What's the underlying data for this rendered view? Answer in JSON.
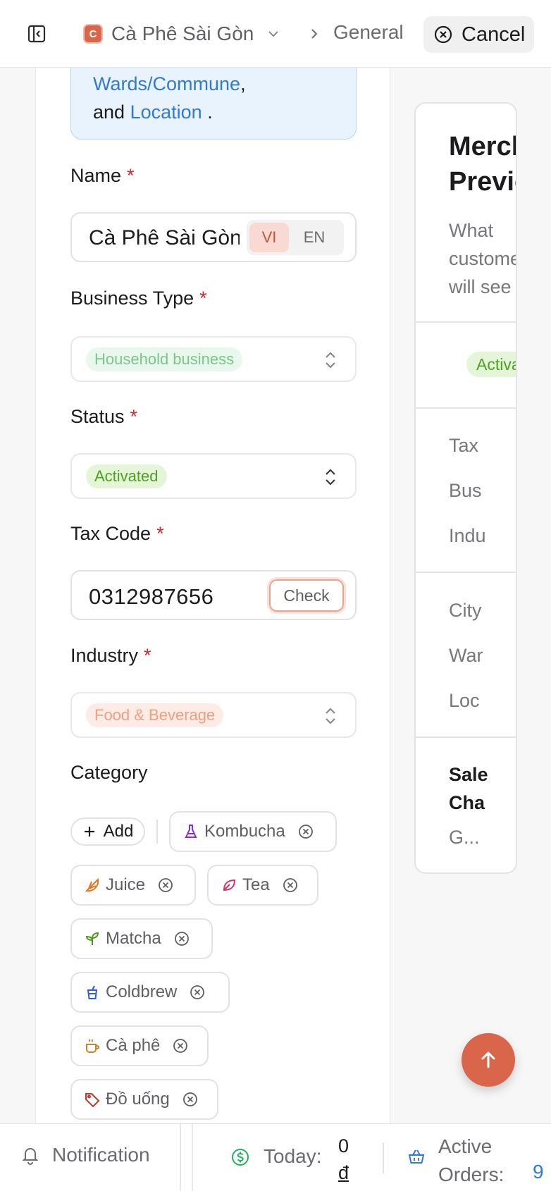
{
  "header": {
    "merchant_initial": "C",
    "merchant_name": "Cà Phê Sài Gòn",
    "breadcrumb_current": "General",
    "cancel_label": "Cancel"
  },
  "form": {
    "info_box": {
      "line1_link": "Wards/Commune",
      "line1_suffix": ",",
      "line2_prefix": "and",
      "line2_link": "Location",
      "line2_suffix": "."
    },
    "name": {
      "label": "Name",
      "required_mark": "*",
      "value": "Cà Phê Sài Gòn",
      "lang_vi": "VI",
      "lang_en": "EN",
      "active_lang": "VI"
    },
    "business_type": {
      "label": "Business Type",
      "required_mark": "*",
      "value": "Household business"
    },
    "status": {
      "label": "Status",
      "required_mark": "*",
      "value": "Activated"
    },
    "tax_code": {
      "label": "Tax Code",
      "required_mark": "*",
      "value": "0312987656",
      "check_label": "Check"
    },
    "industry": {
      "label": "Industry",
      "required_mark": "*",
      "value": "Food & Beverage"
    },
    "category": {
      "label": "Category",
      "add_label": "Add",
      "items": [
        {
          "label": "Kombucha",
          "icon": "flask-icon",
          "color": "#8a2be2"
        },
        {
          "label": "Juice",
          "icon": "citrus-icon",
          "color": "#e8731c"
        },
        {
          "label": "Tea",
          "icon": "leaf-icon",
          "color": "#d6336c"
        },
        {
          "label": "Matcha",
          "icon": "sprout-icon",
          "color": "#4e9a1e"
        },
        {
          "label": "Coldbrew",
          "icon": "cup-straw-icon",
          "color": "#2f5fd6"
        },
        {
          "label": "Cà phê",
          "icon": "coffee-icon",
          "color": "#c7842a"
        },
        {
          "label": "Đồ uống",
          "icon": "tag-icon",
          "color": "#c0392b"
        }
      ]
    }
  },
  "preview": {
    "title_line1": "Merchant",
    "title_line2": "Preview",
    "subtitle_line1": "What",
    "subtitle_line2": "customers",
    "subtitle_line3": "will see",
    "status": "Activated",
    "rows_group1": [
      "Tax",
      "Bus",
      "Indu"
    ],
    "rows_group2": [
      "City",
      "War",
      "Loc"
    ],
    "sales_line1": "Sale",
    "sales_line2": "Cha",
    "sales_value": "G..."
  },
  "footer": {
    "notification_label": "Notification",
    "today_label": "Today:",
    "today_value": "0",
    "today_currency": "đ",
    "orders_label_line1": "Active",
    "orders_label_line2": "Orders:",
    "orders_value": "9"
  },
  "colors": {
    "accent": "#d9654a",
    "link": "#2f7ad6",
    "required": "#d2262f",
    "status_green": "#4ea022"
  }
}
